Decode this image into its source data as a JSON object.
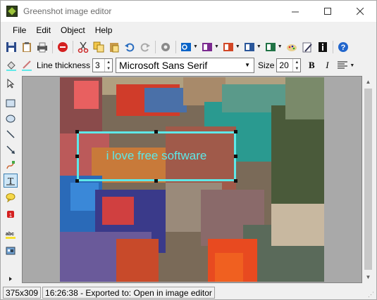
{
  "window": {
    "title": "Greenshot image editor"
  },
  "menu": {
    "items": [
      "File",
      "Edit",
      "Object",
      "Help"
    ]
  },
  "toolbar": {
    "icons": [
      "save-icon",
      "clipboard-icon",
      "print-icon",
      "stop-icon",
      "cut-icon",
      "copy-icon",
      "paste-icon",
      "undo-icon",
      "redo-icon",
      "settings-icon",
      "outlook-icon",
      "onenote-icon",
      "powerpoint-icon",
      "word-icon",
      "excel-icon",
      "paint-icon",
      "edit-icon",
      "info-icon",
      "help-icon"
    ]
  },
  "properties": {
    "line_thickness_label": "Line thickness",
    "line_thickness_value": "3",
    "font_name": "Microsoft Sans Serif",
    "size_label": "Size",
    "size_value": "20",
    "bold_label": "B",
    "italic_label": "I"
  },
  "canvas": {
    "text_annotation": "i love free software",
    "text_color": "#5ee8e8"
  },
  "status": {
    "dimensions": "375x309",
    "message": "16:26:38 - Exported to: Open in image editor"
  }
}
